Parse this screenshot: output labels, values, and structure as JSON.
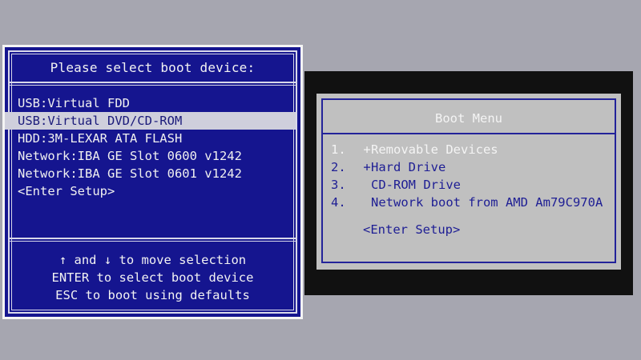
{
  "left_screen": {
    "title": "Please select boot device:",
    "devices": [
      {
        "label": "USB:Virtual FDD",
        "selected": false
      },
      {
        "label": "USB:Virtual DVD/CD-ROM",
        "selected": true
      },
      {
        "label": "HDD:3M-LEXAR ATA FLASH",
        "selected": false
      },
      {
        "label": "Network:IBA GE Slot 0600 v1242",
        "selected": false
      },
      {
        "label": "Network:IBA GE Slot 0601 v1242",
        "selected": false
      },
      {
        "label": "<Enter Setup>",
        "selected": false
      }
    ],
    "help": [
      "↑ and ↓ to move selection",
      "ENTER to select boot device",
      "ESC to boot using defaults"
    ],
    "colors": {
      "background": "#15158f",
      "text": "#f0f0f0",
      "highlight": "#cfcfdc"
    }
  },
  "right_screen": {
    "title": "Boot Menu",
    "items": [
      {
        "number": "1.",
        "marker": "+",
        "label": "Removable Devices",
        "selected": true
      },
      {
        "number": "2.",
        "marker": "+",
        "label": "Hard Drive",
        "selected": false
      },
      {
        "number": "3.",
        "marker": "",
        "label": "CD-ROM Drive",
        "selected": false
      },
      {
        "number": "4.",
        "marker": "",
        "label": "Network boot from AMD Am79C970A",
        "selected": false
      }
    ],
    "setup": "<Enter Setup>",
    "colors": {
      "panel": "#c0c0c0",
      "text": "#1e1e94",
      "selected_text": "#f4f4f4"
    }
  }
}
